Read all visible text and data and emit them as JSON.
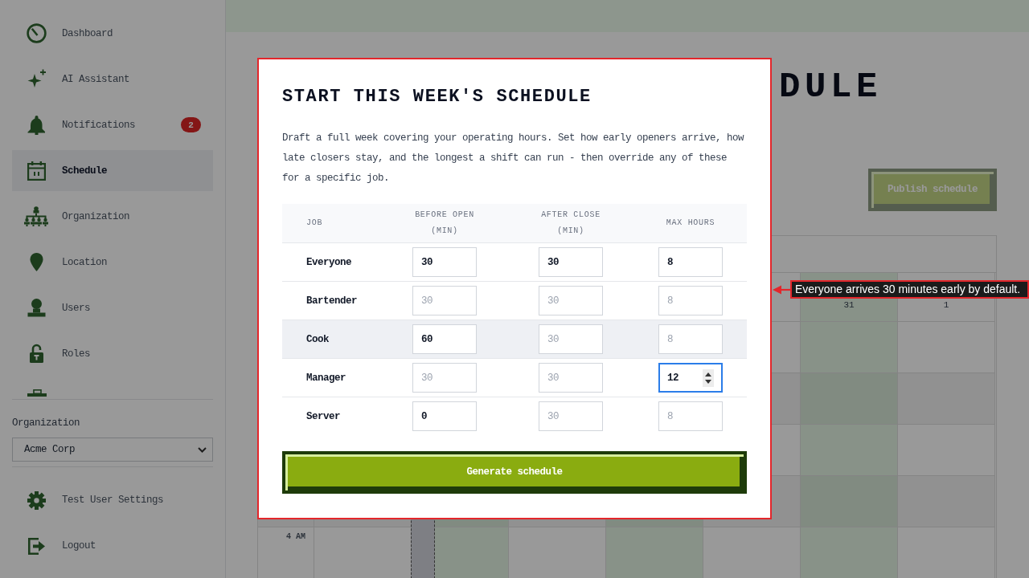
{
  "sidebar": {
    "nav_items": [
      {
        "label": "Dashboard",
        "selected": false
      },
      {
        "label": "AI Assistant",
        "selected": false
      },
      {
        "label": "Notifications",
        "selected": false,
        "badge": "2"
      },
      {
        "label": "Schedule",
        "selected": true
      },
      {
        "label": "Organization",
        "selected": false
      },
      {
        "label": "Location",
        "selected": false
      },
      {
        "label": "Users",
        "selected": false
      },
      {
        "label": "Roles",
        "selected": false
      }
    ],
    "organization_picker": {
      "label": "Organization",
      "value": "Acme Corp"
    },
    "footer_items": [
      {
        "label": "Test User Settings"
      },
      {
        "label": "Logout"
      }
    ]
  },
  "main": {
    "page_title": "DULE",
    "publish_button": {
      "label": "Publish schedule",
      "disabled": true
    },
    "calendar": {
      "columns": [
        {
          "kind": "day",
          "shaded": false
        },
        {
          "kind": "gap"
        },
        {
          "kind": "day",
          "shaded": true
        },
        {
          "kind": "day",
          "shaded": false
        },
        {
          "kind": "day",
          "shaded": true
        },
        {
          "kind": "day",
          "shaded": false
        },
        {
          "kind": "day",
          "shaded": true,
          "day": "31"
        },
        {
          "kind": "day",
          "shaded": false,
          "day": "1"
        }
      ],
      "time_labels": [
        "4 AM"
      ]
    }
  },
  "dialog": {
    "outlined": true,
    "title": "START THIS WEEK'S SCHEDULE",
    "description": "Draft a full week covering your operating hours. Set how early openers arrive, how late closers stay, and the longest a shift can run - then override any of these for a specific job.",
    "table": {
      "columns": [
        "JOB",
        "BEFORE OPEN (MIN)",
        "AFTER CLOSE (MIN)",
        "MAX HOURS"
      ],
      "rows": [
        {
          "highlighted": false,
          "cells": [
            {
              "kind": "label",
              "text": "Everyone"
            },
            {
              "kind": "input",
              "value": "30",
              "focused": false
            },
            {
              "kind": "input",
              "value": "30",
              "focused": false
            },
            {
              "kind": "input",
              "value": "8",
              "focused": false
            }
          ]
        },
        {
          "highlighted": false,
          "cells": [
            {
              "kind": "label",
              "text": "Bartender"
            },
            {
              "kind": "input",
              "placeholder": "30",
              "focused": false
            },
            {
              "kind": "input",
              "placeholder": "30",
              "focused": false
            },
            {
              "kind": "input",
              "placeholder": "8",
              "focused": false
            }
          ]
        },
        {
          "highlighted": true,
          "cells": [
            {
              "kind": "label",
              "text": "Cook"
            },
            {
              "kind": "input",
              "value": "60",
              "focused": false
            },
            {
              "kind": "input",
              "placeholder": "30",
              "focused": false
            },
            {
              "kind": "input",
              "placeholder": "8",
              "focused": false
            }
          ]
        },
        {
          "highlighted": false,
          "cells": [
            {
              "kind": "label",
              "text": "Manager"
            },
            {
              "kind": "input",
              "placeholder": "30",
              "focused": false
            },
            {
              "kind": "input",
              "placeholder": "30",
              "focused": false
            },
            {
              "kind": "input",
              "value": "12",
              "focused": true
            }
          ]
        },
        {
          "highlighted": false,
          "cells": [
            {
              "kind": "label",
              "text": "Server"
            },
            {
              "kind": "input",
              "value": "0",
              "focused": false
            },
            {
              "kind": "input",
              "placeholder": "30",
              "focused": false
            },
            {
              "kind": "input",
              "placeholder": "8",
              "focused": false
            }
          ]
        }
      ]
    },
    "generate_button": {
      "label": "Generate schedule"
    }
  },
  "annotation": {
    "text": "Everyone arrives 30 minutes early by default."
  }
}
